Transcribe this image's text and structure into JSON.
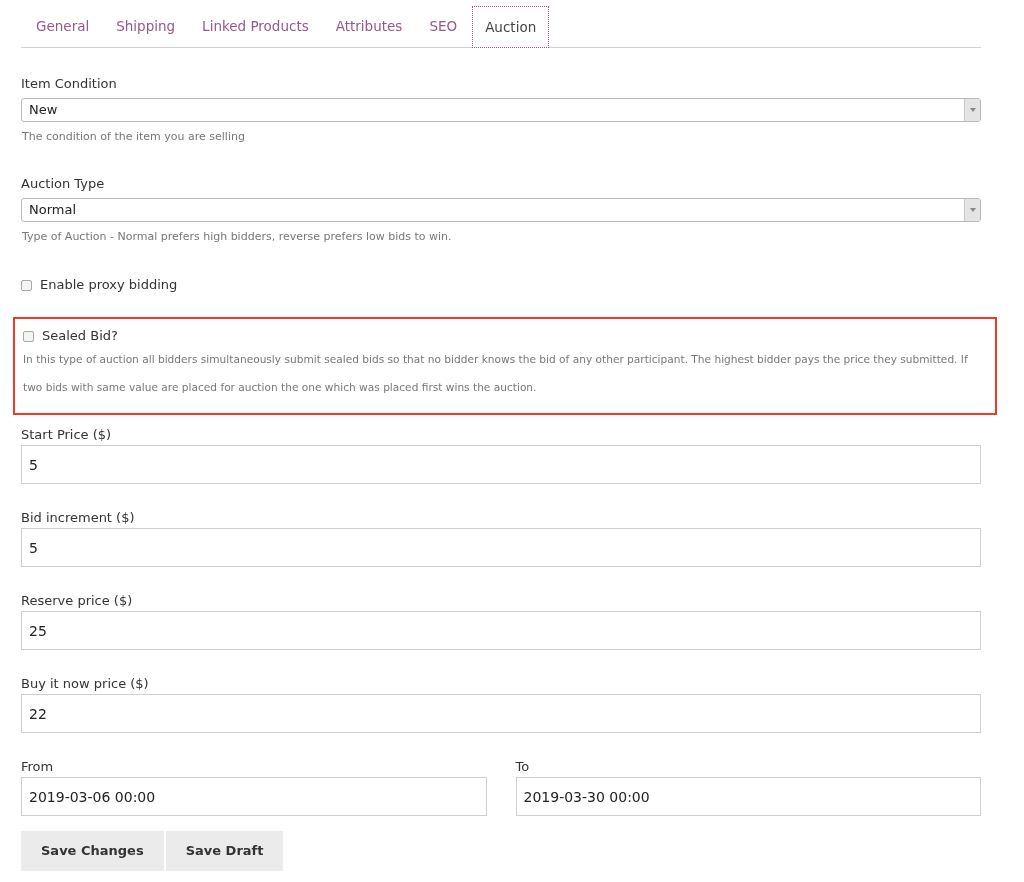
{
  "tabs": [
    {
      "label": "General",
      "selected": false
    },
    {
      "label": "Shipping",
      "selected": false
    },
    {
      "label": "Linked Products",
      "selected": false
    },
    {
      "label": "Attributes",
      "selected": false
    },
    {
      "label": "SEO",
      "selected": false
    },
    {
      "label": "Auction",
      "selected": true
    }
  ],
  "selects": [
    {
      "label": "Item Condition",
      "value": "New",
      "hint": "The condition of the item you are selling"
    },
    {
      "label": "Auction Type",
      "value": "Normal",
      "hint": "Type of Auction - Normal prefers high bidders, reverse prefers low bids to win."
    }
  ],
  "proxy_bidding": {
    "label": "Enable proxy bidding",
    "checked": false
  },
  "sealed_bid": {
    "label": "Sealed Bid?",
    "checked": false,
    "highlighted": true,
    "description": "In this type of auction all bidders simultaneously submit sealed bids so that no bidder knows the bid of any other participant. The highest bidder pays the price they submitted. If two bids with same value are placed for auction the one which was placed first wins the auction."
  },
  "price_fields": [
    {
      "label": "Start Price ($)",
      "value": "5"
    },
    {
      "label": "Bid increment ($)",
      "value": "5"
    },
    {
      "label": "Reserve price ($)",
      "value": "25"
    },
    {
      "label": "Buy it now price ($)",
      "value": "22"
    }
  ],
  "date_fields": [
    {
      "label": "From",
      "value": "2019-03-06 00:00"
    },
    {
      "label": "To",
      "value": "2019-03-30 00:00"
    }
  ],
  "buttons": [
    "Save Changes",
    "Save Draft"
  ]
}
